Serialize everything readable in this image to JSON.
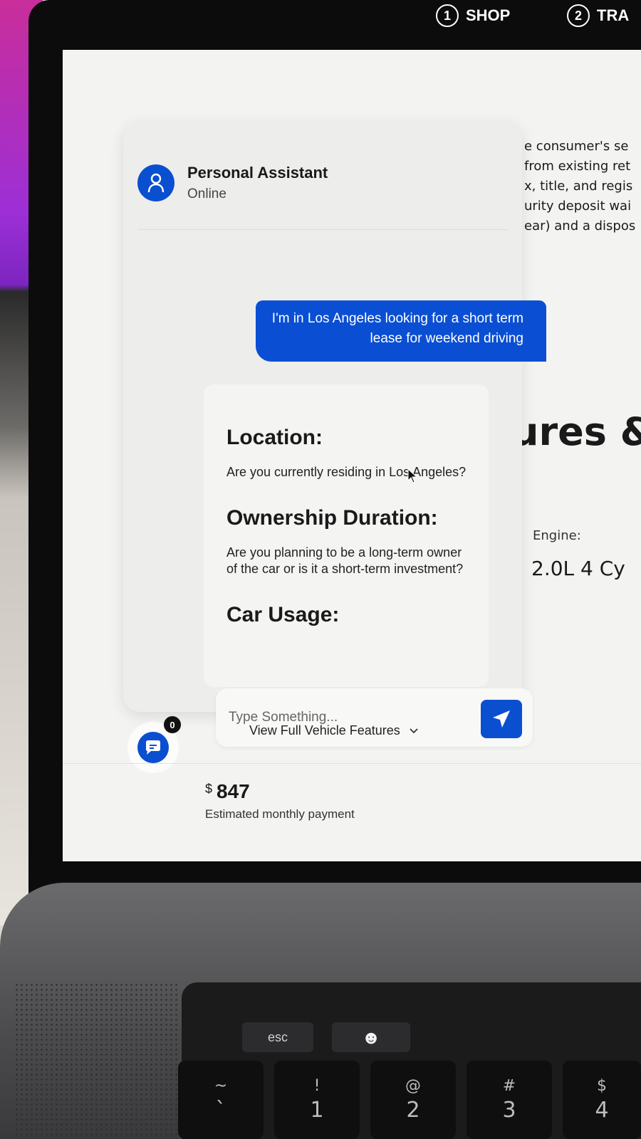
{
  "nav": {
    "steps": [
      {
        "number": "1",
        "label": "SHOP"
      },
      {
        "number": "2",
        "label": "TRA"
      }
    ]
  },
  "background_page": {
    "text_lines": [
      "e consumer's se",
      "from existing ret",
      "x, title, and regis",
      "urity deposit wai",
      "ear) and a dispos"
    ],
    "heading_fragment": "ures &",
    "engine_label": "Engine:",
    "engine_value": "2.0L 4 Cy"
  },
  "chat": {
    "header": {
      "title": "Personal Assistant",
      "status": "Online",
      "avatar_icon": "user-icon"
    },
    "user_message": "I'm in Los Angeles looking for a short term lease for weekend driving",
    "questions": [
      {
        "title": "Location:",
        "body": "Are you currently residing in Los Angeles?"
      },
      {
        "title": "Ownership Duration:",
        "body": "Are you planning to be a long-term owner of the car or is it a short-term investment?"
      },
      {
        "title": "Car Usage:",
        "body": ""
      }
    ],
    "input": {
      "placeholder": "Type Something..."
    },
    "send_icon": "send-icon"
  },
  "page": {
    "chat_badge_count": "0",
    "view_features_label": "View Full Vehicle Features",
    "price_symbol": "$",
    "price_value": "847",
    "price_label": "Estimated monthly payment"
  },
  "keyboard": {
    "esc_label": "esc",
    "keys": [
      {
        "top": "~",
        "bottom": "`"
      },
      {
        "top": "!",
        "bottom": "1"
      },
      {
        "top": "@",
        "bottom": "2"
      },
      {
        "top": "#",
        "bottom": "3"
      },
      {
        "top": "$",
        "bottom": "4"
      }
    ]
  },
  "colors": {
    "accent": "#0b4fd1",
    "panel": "#ededec",
    "bezel": "#0c0c0d"
  }
}
